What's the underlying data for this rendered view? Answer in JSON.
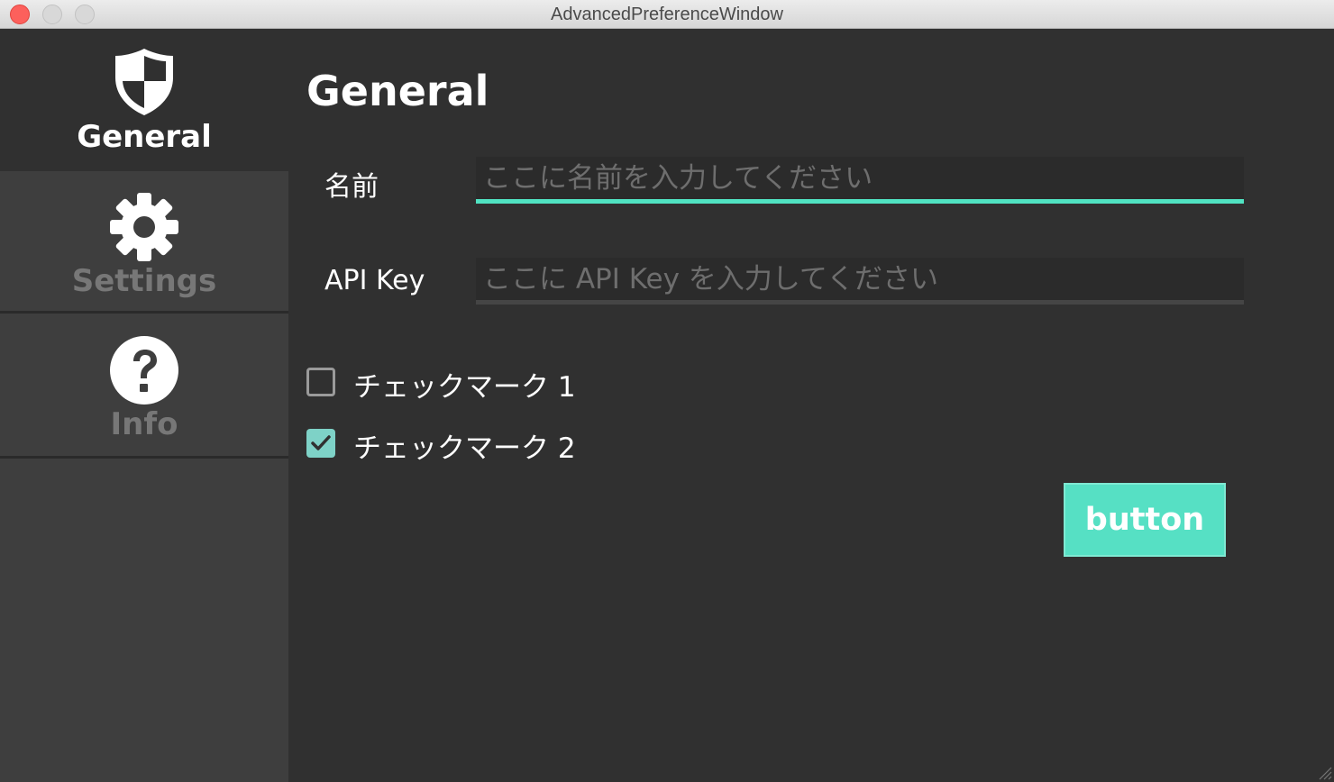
{
  "window": {
    "title": "AdvancedPreferenceWindow"
  },
  "sidebar": {
    "items": [
      {
        "label": "General",
        "icon": "shield-icon",
        "active": true
      },
      {
        "label": "Settings",
        "icon": "gear-icon",
        "active": false
      },
      {
        "label": "Info",
        "icon": "question-circle-icon",
        "active": false
      }
    ]
  },
  "main": {
    "title": "General",
    "fields": [
      {
        "label": "名前",
        "placeholder": "ここに名前を入力してください",
        "value": ""
      },
      {
        "label": "API Key",
        "placeholder": "ここに API Key を入力してください",
        "value": ""
      }
    ],
    "checkboxes": [
      {
        "label": "チェックマーク 1",
        "checked": false
      },
      {
        "label": "チェックマーク 2",
        "checked": true
      }
    ],
    "button_label": "button"
  },
  "colors": {
    "accent": "#50e3c2",
    "button": "#56e0c4",
    "checkbox_checked": "#7ed2c7",
    "background": "#303030",
    "sidebar": "#3e3e3e"
  }
}
